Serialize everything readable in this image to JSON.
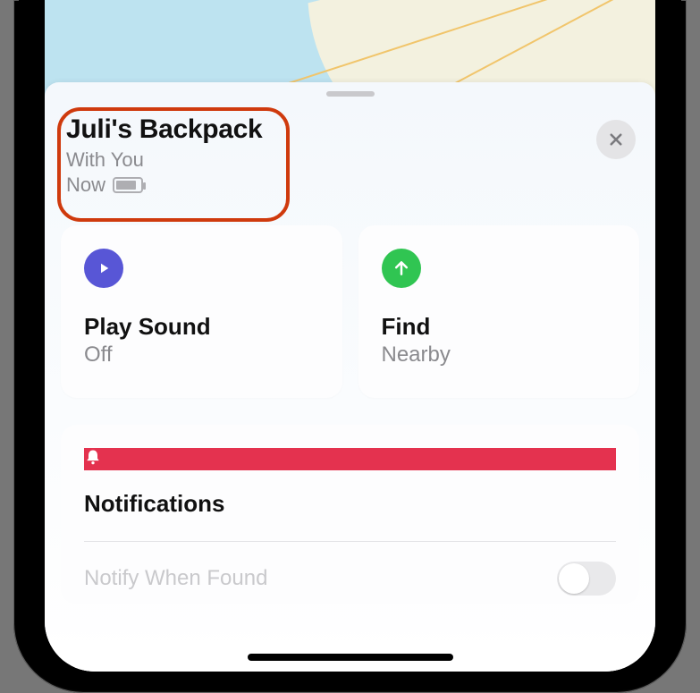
{
  "header": {
    "title": "Juli's Backpack",
    "location_status": "With You",
    "time_status": "Now"
  },
  "actions": {
    "play_sound": {
      "label": "Play Sound",
      "status": "Off"
    },
    "find": {
      "label": "Find",
      "status": "Nearby"
    }
  },
  "notifications": {
    "section_title": "Notifications",
    "notify_when_found": {
      "label": "Notify When Found"
    }
  }
}
